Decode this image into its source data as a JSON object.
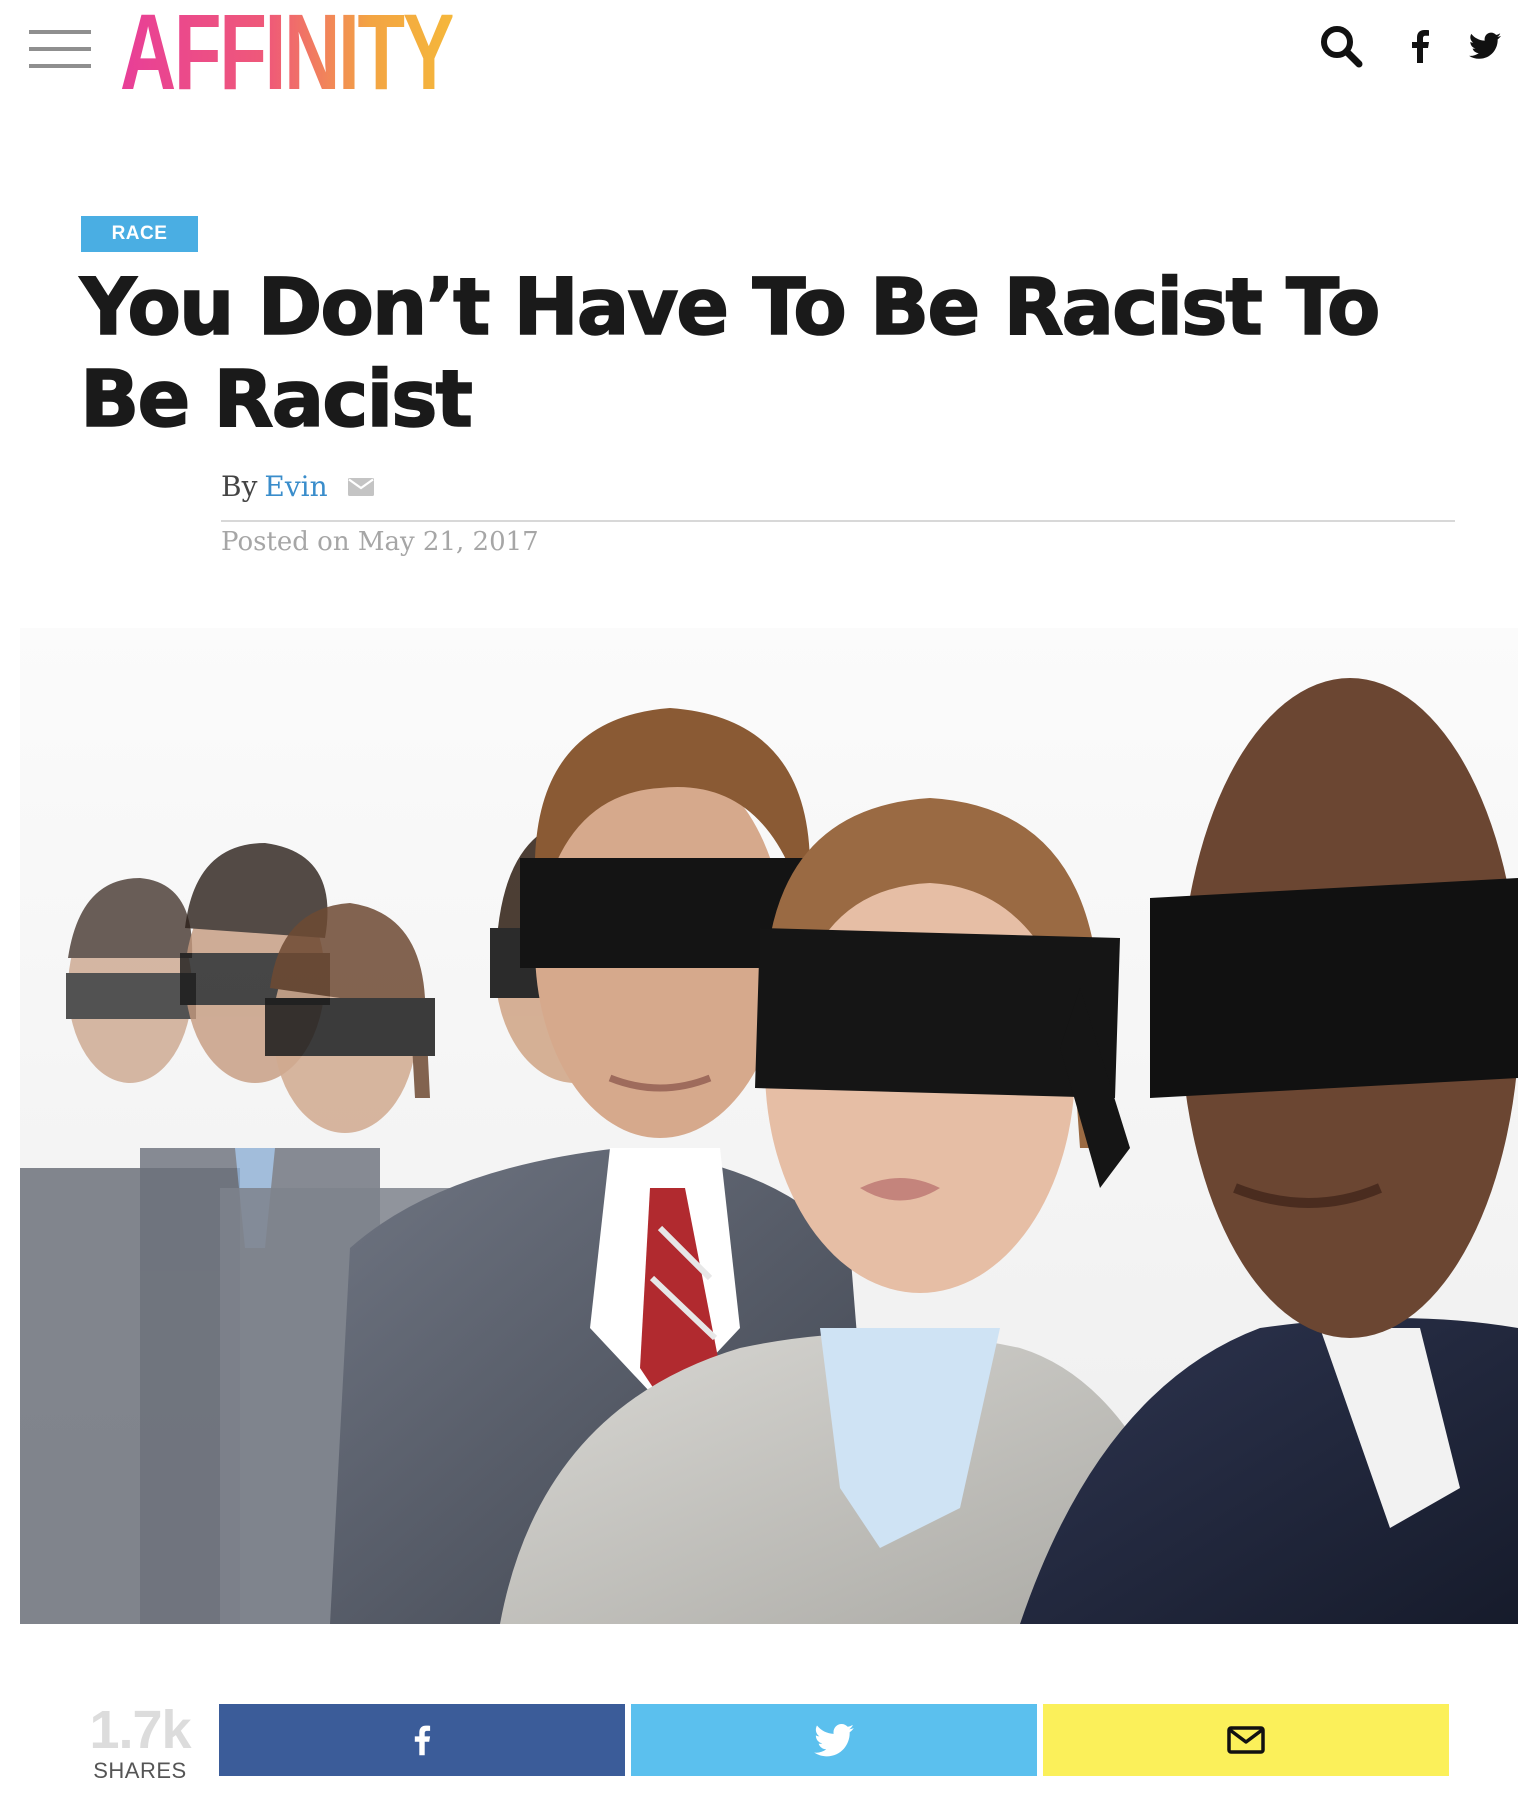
{
  "header": {
    "logo_text": "AFFINITY",
    "brand_colors": [
      "#e83e98",
      "#ef5a78",
      "#f3a443",
      "#f5b73b"
    ],
    "icons": [
      "menu-icon",
      "search-icon",
      "facebook-icon",
      "twitter-icon"
    ]
  },
  "article": {
    "category": "RACE",
    "category_color": "#4aaee3",
    "title": "You Don’t Have To Be Racist To Be Racist",
    "byline_prefix": "By",
    "author": "Evin",
    "author_color": "#3a8dcb",
    "posted": "Posted on May 21, 2017"
  },
  "share": {
    "count": "1.7k",
    "count_label": "SHARES",
    "buttons": [
      {
        "network": "facebook",
        "icon": "facebook-icon",
        "color": "#3b5c99"
      },
      {
        "network": "twitter",
        "icon": "twitter-icon",
        "color": "#5bc0ee"
      },
      {
        "network": "email",
        "icon": "envelope-icon",
        "color": "#fbf05a"
      }
    ]
  }
}
